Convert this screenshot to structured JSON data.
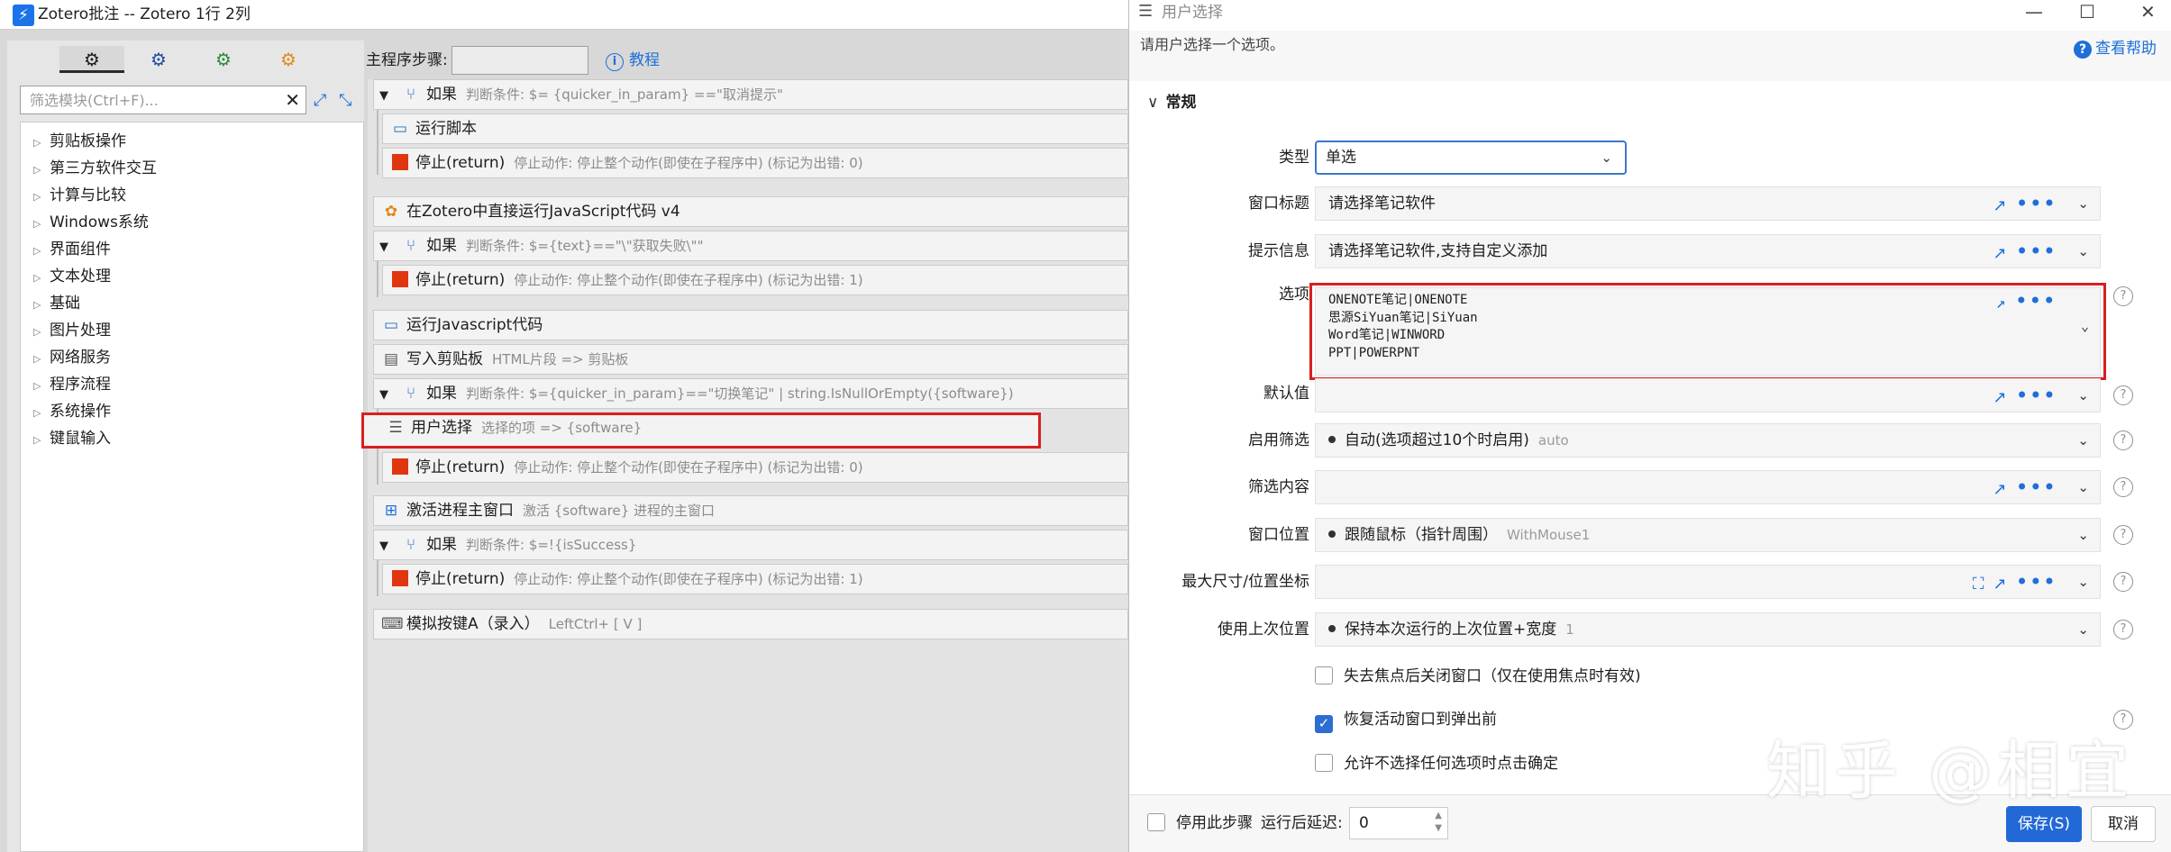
{
  "main_window": {
    "title": "Zotero批注 -- Zotero 1行 2列",
    "app_icon": "⚡"
  },
  "module_panel": {
    "tabs": [
      "⚙",
      "⚙",
      "⚙",
      "⚙"
    ],
    "filter_placeholder": "筛选模块(Ctrl+F)...",
    "tree_items": [
      "剪贴板操作",
      "第三方软件交互",
      "计算与比较",
      "Windows系统",
      "界面组件",
      "文本处理",
      "基础",
      "图片处理",
      "网络服务",
      "程序流程",
      "系统操作",
      "键鼠输入"
    ]
  },
  "toolbar": {
    "steps_label": "主程序步骤:",
    "steps_value": "",
    "tutorial_label": "教程"
  },
  "steps": [
    {
      "caret": "▼",
      "icon": "branch-icon",
      "glyph": "⑂",
      "title": "如果",
      "desc": "判断条件: $= {quicker_in_param} ==\"取消提示\""
    },
    {
      "icon": "script-icon",
      "glyph": "▭",
      "title": "运行脚本",
      "desc": ""
    },
    {
      "icon": "stop-icon",
      "title": "停止(return)",
      "desc": "停止动作: 停止整个动作(即使在子程序中) (标记为出错: 0)"
    },
    {
      "icon": "plugin-icon",
      "glyph": "✿",
      "title": "在Zotero中直接运行JavaScript代码 v4",
      "desc": ""
    },
    {
      "caret": "▼",
      "icon": "branch-icon",
      "glyph": "⑂",
      "title": "如果",
      "desc": "判断条件: $={text}==\"\\\"获取失败\\\"\""
    },
    {
      "icon": "stop-icon",
      "title": "停止(return)",
      "desc": "停止动作: 停止整个动作(即使在子程序中) (标记为出错: 1)"
    },
    {
      "icon": "script-icon",
      "glyph": "▭",
      "title": "运行Javascript代码",
      "desc": ""
    },
    {
      "icon": "clipboard-icon",
      "glyph": "▤",
      "title": "写入剪贴板",
      "desc": "HTML片段 => 剪贴板"
    },
    {
      "caret": "▼",
      "icon": "branch-icon",
      "glyph": "⑂",
      "title": "如果",
      "desc": "判断条件: $={quicker_in_param}==\"切换笔记\" | string.IsNullOrEmpty({software})"
    },
    {
      "icon": "list-icon",
      "glyph": "☰",
      "title": "用户选择",
      "desc": "选择的项 => {software}"
    },
    {
      "icon": "stop-icon",
      "title": "停止(return)",
      "desc": "停止动作: 停止整个动作(即使在子程序中) (标记为出错: 0)"
    },
    {
      "icon": "windows-icon",
      "glyph": "⊞",
      "title": "激活进程主窗口",
      "desc": "激活 {software} 进程的主窗口"
    },
    {
      "caret": "▼",
      "icon": "branch-icon",
      "glyph": "⑂",
      "title": "如果",
      "desc": "判断条件: $=!{isSuccess}"
    },
    {
      "icon": "stop-icon",
      "title": "停止(return)",
      "desc": "停止动作: 停止整个动作(即使在子程序中) (标记为出错: 1)"
    },
    {
      "icon": "keyboard-icon",
      "glyph": "⌨",
      "title": "模拟按键A（录入）",
      "desc": "LeftCtrl+ [ V ]"
    }
  ],
  "dialog": {
    "title": "用户选择",
    "subtitle": "请用户选择一个选项。",
    "help_label": "查看帮助",
    "section": "常规",
    "fields": {
      "type": {
        "label": "类型",
        "value": "单选"
      },
      "window_title": {
        "label": "窗口标题",
        "value": "请选择笔记软件"
      },
      "prompt": {
        "label": "提示信息",
        "value": "请选择笔记软件,支持自定义添加"
      },
      "options": {
        "label": "选项",
        "lines": [
          "ONENOTE笔记|ONENOTE",
          "思源SiYuan笔记|SiYuan",
          "Word笔记|WINWORD",
          "PPT|POWERPNT"
        ]
      },
      "default": {
        "label": "默认值",
        "value": ""
      },
      "filter_enable": {
        "label": "启用筛选",
        "value": "自动(选项超过10个时启用)",
        "hint": "auto"
      },
      "filter_content": {
        "label": "筛选内容",
        "value": ""
      },
      "window_position": {
        "label": "窗口位置",
        "value": "跟随鼠标（指针周围）",
        "hint": "WithMouse1"
      },
      "max_size": {
        "label": "最大尺寸/位置坐标",
        "value": ""
      },
      "last_position": {
        "label": "使用上次位置",
        "value": "保持本次运行的上次位置+宽度",
        "hint": "1"
      }
    },
    "checkboxes": [
      {
        "label": "失去焦点后关闭窗口（仅在使用焦点时有效)",
        "checked": false
      },
      {
        "label": "恢复活动窗口到弹出前",
        "checked": true
      },
      {
        "label": "允许不选择任何选项时点击确定",
        "checked": false
      }
    ],
    "footer": {
      "disable_label": "停用此步骤",
      "delay_label": "运行后延迟:",
      "delay_value": "0",
      "save_label": "保存(S)",
      "cancel_label": "取消"
    }
  },
  "watermark": "知乎 @相宜",
  "colors": {
    "accent": "#2268d6",
    "highlight": "#d91f1f",
    "stop": "#e0360f"
  }
}
